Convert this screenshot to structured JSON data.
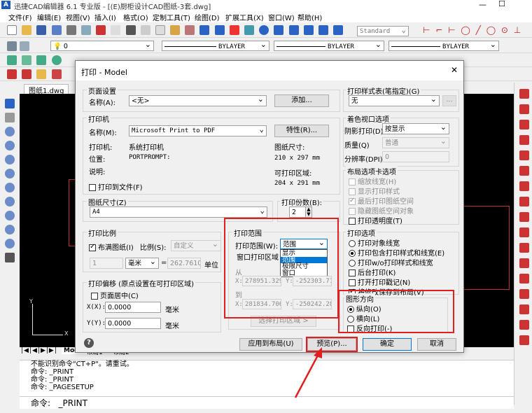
{
  "app": {
    "title": "迅捷CAD编辑器 6.1 专业版 - [(E)厨柜设计CAD图纸-3套.dwg]",
    "minimize": "—",
    "maximize": "☐"
  },
  "menu": [
    "文件(F)",
    "编辑(E)",
    "视图(V)",
    "插入(I)",
    "格式(O)",
    "定制工具(T)",
    "绘图(D)",
    "扩展工具(X)",
    "窗口(W)",
    "帮助(H)"
  ],
  "toolbar": {
    "style_value": "Standard",
    "layer_value": "0",
    "linetype1": "BYLAYER",
    "linetype2": "BYLAYER",
    "linetype3": "BYLAYER"
  },
  "doc_tab": "图纸1.dwg",
  "bottom_tabs": {
    "model": "Model",
    "layout1": "布局1",
    "layout2": "布局2"
  },
  "command": {
    "lines": [
      "不能识别命令\"CT+P\"。请重试。",
      "命令:  _PRINT",
      "命令:  _PRINT",
      "命令:  _PAGESETUP"
    ],
    "prompt": "命令:",
    "current": "_PRINT"
  },
  "dialog": {
    "title": "打印 - Model",
    "close": "✕",
    "page_setup": {
      "group": "页面设置",
      "name_label": "名称(A):",
      "name_value": "<无>",
      "add_btn": "添加..."
    },
    "printer": {
      "group": "打印机",
      "name_label": "名称(M):",
      "name_value": "Microsoft Print to PDF",
      "props_btn": "特性(R)...",
      "printer_label": "打印机:",
      "printer_value": "系统打印机",
      "location_label": "位置:",
      "location_value": "PORTPROMPT:",
      "desc_label": "说明:",
      "print_to_file": "打印到文件(F)",
      "paper_size_label": "图纸尺寸:",
      "paper_size_value": "210 x 297 mm",
      "printable_label": "可打印区域:",
      "printable_value": "204 x 291 mm"
    },
    "paper": {
      "group": "图纸尺寸(Z)",
      "value": "A4"
    },
    "copies": {
      "group": "打印份数(B):",
      "value": "2"
    },
    "scale": {
      "group": "打印比例",
      "fit_label": "布满图纸(I)",
      "ratio_label": "比例(S):",
      "ratio_value": "自定义",
      "num1": "1",
      "unit": "毫米",
      "num2": "262.7610",
      "unit2": "单位"
    },
    "offset": {
      "group": "打印偏移 (原点设置在可打印区域)",
      "center": "页面居中(C)",
      "x_label": "X(X):",
      "x_value": "0.0000",
      "x_unit": "毫米",
      "y_label": "Y(Y):",
      "y_value": "0.0000",
      "y_unit": "毫米"
    },
    "range": {
      "group": "打印范围",
      "label": "打印范围(W):",
      "selected": "范围",
      "options": [
        "显示",
        "范围",
        "极限尺寸",
        "窗口"
      ],
      "highlighted": "范围",
      "window_area": "窗口打印区域",
      "from": "从",
      "to": "到",
      "x1_label": "X:",
      "x1": "278951.329",
      "y1_label": "Y:",
      "y1": "-252303.71",
      "x2_label": "X:",
      "x2": "281834.706",
      "y2_label": "Y:",
      "y2": "-250242.28",
      "select_btn": "选择打印区域 >"
    },
    "style_table": {
      "group": "打印样式表(笔指定)(G)",
      "value": "无",
      "more": "..."
    },
    "viewport": {
      "group": "着色视口选项",
      "shade_label": "阴影打印(D)",
      "shade_value": "按显示",
      "quality_label": "质量(Q)",
      "quality_value": "普通",
      "dpi_label": "分辨率(DPI)",
      "dpi_value": "0"
    },
    "layout_opts": {
      "group": "布局选项卡选项",
      "items": [
        {
          "label": "缩放线宽(H)",
          "checked": false,
          "enabled": false
        },
        {
          "label": "显示打印样式",
          "checked": false,
          "enabled": false
        },
        {
          "label": "最后打印图纸空间",
          "checked": true,
          "enabled": false
        },
        {
          "label": "隐藏图纸空间对象",
          "checked": false,
          "enabled": false
        },
        {
          "label": "打印透明度(T)",
          "checked": false,
          "enabled": true
        }
      ]
    },
    "print_opts": {
      "group": "打印选项",
      "items": [
        {
          "label": "打印对象线宽",
          "type": "radio",
          "checked": false
        },
        {
          "label": "打印包含打印样式和线宽(E)",
          "type": "radio",
          "checked": true
        },
        {
          "label": "打印w/o打印样式和线宽",
          "type": "radio",
          "checked": false
        },
        {
          "label": "后台打印(K)",
          "type": "check",
          "checked": false
        },
        {
          "label": "打开打印戳记(N)",
          "type": "check",
          "checked": false
        },
        {
          "label": "将修改保存到布局(V)",
          "type": "check",
          "checked": true
        }
      ]
    },
    "orientation": {
      "group": "图形方向",
      "portrait": "纵向(O)",
      "landscape": "横向(L)",
      "reverse": "反向打印(-)"
    },
    "buttons": {
      "help": "?",
      "apply": "应用到布局(U)",
      "preview": "预览(P)...",
      "ok": "确定",
      "cancel": "取消"
    }
  }
}
